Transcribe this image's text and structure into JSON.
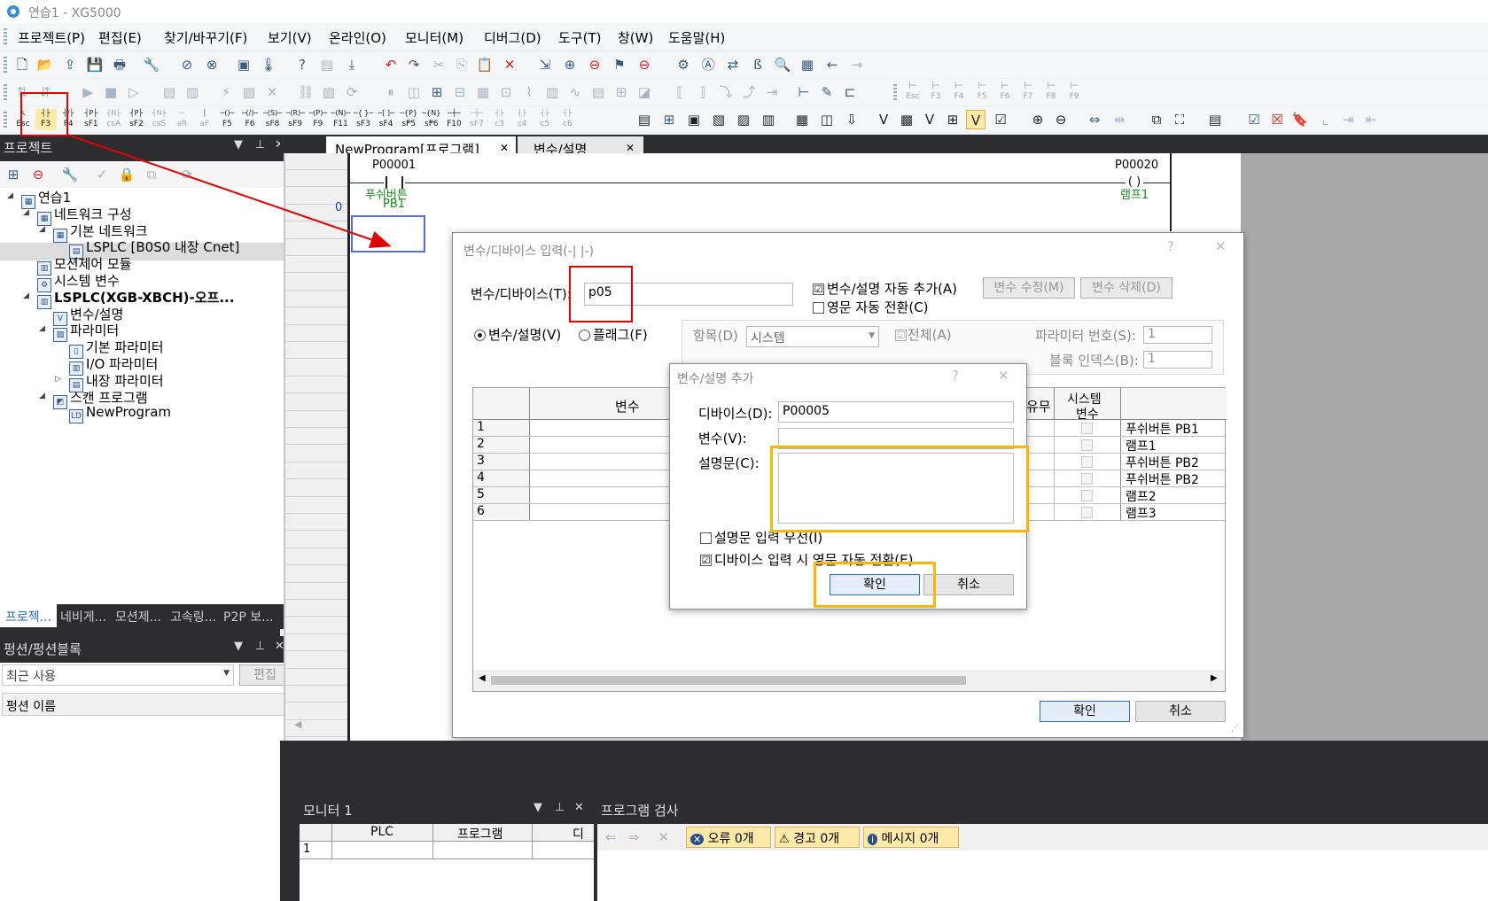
{
  "window": {
    "title": "연습1 - XG5000"
  },
  "menu": [
    "프로젝트(P)",
    "편집(E)",
    "찾기/바꾸기(F)",
    "보기(V)",
    "온라인(O)",
    "모니터(M)",
    "디버그(D)",
    "도구(T)",
    "창(W)",
    "도움말(H)"
  ],
  "toolbar3_keys": [
    {
      "top": "Esc",
      "bot": ""
    },
    {
      "top": "F3",
      "bot": ""
    },
    {
      "top": "F4",
      "bot": ""
    },
    {
      "top": "sF1",
      "bot": ""
    },
    {
      "top": "csA",
      "bot": ""
    },
    {
      "top": "sF2",
      "bot": ""
    },
    {
      "top": "csS",
      "bot": ""
    },
    {
      "top": "aR",
      "bot": ""
    },
    {
      "top": "aF",
      "bot": ""
    },
    {
      "top": "F5",
      "bot": ""
    },
    {
      "top": "F6",
      "bot": ""
    },
    {
      "top": "sF8",
      "bot": ""
    },
    {
      "top": "sF9",
      "bot": ""
    },
    {
      "top": "F9",
      "bot": ""
    },
    {
      "top": "F11",
      "bot": ""
    },
    {
      "top": "sF3",
      "bot": ""
    },
    {
      "top": "sF4",
      "bot": ""
    },
    {
      "top": "sF5",
      "bot": ""
    },
    {
      "top": "sF6",
      "bot": ""
    },
    {
      "top": "F10",
      "bot": ""
    },
    {
      "top": "sF7",
      "bot": ""
    },
    {
      "top": "c3",
      "bot": ""
    },
    {
      "top": "c4",
      "bot": ""
    },
    {
      "top": "c5",
      "bot": ""
    },
    {
      "top": "c6",
      "bot": ""
    }
  ],
  "toolbar2_keys": [
    "Esc",
    "F3",
    "F4",
    "F5",
    "F6",
    "F7",
    "F8",
    "F9"
  ],
  "project_panel": {
    "title": "프로젝트",
    "tree": [
      {
        "label": "연습1",
        "level": 0
      },
      {
        "label": "네트워크 구성",
        "level": 1
      },
      {
        "label": "기본 네트워크",
        "level": 2
      },
      {
        "label": "LSPLC [B0S0 내장 Cnet]",
        "level": 3
      },
      {
        "label": "모션제어 모듈",
        "level": 1
      },
      {
        "label": "시스템 변수",
        "level": 1
      },
      {
        "label": "LSPLC(XGB-XBCH)-오프...",
        "level": 1
      },
      {
        "label": "변수/설명",
        "level": 2
      },
      {
        "label": "파라미터",
        "level": 2
      },
      {
        "label": "기본 파라미터",
        "level": 3
      },
      {
        "label": "I/O 파라미터",
        "level": 3
      },
      {
        "label": "내장 파라미터",
        "level": 3
      },
      {
        "label": "스캔 프로그램",
        "level": 2
      },
      {
        "label": "NewProgram",
        "level": 3
      }
    ],
    "bottom_tabs": [
      "프로젝...",
      "네비게...",
      "모션제...",
      "고속링...",
      "P2P 보..."
    ]
  },
  "function_panel": {
    "title": "펑션/펑션블록",
    "combo_value": "최근 사용",
    "edit_button": "편집",
    "column": "펑션 이름"
  },
  "tabs": [
    {
      "label": "NewProgram[프로그램]",
      "close": "✕"
    },
    {
      "label": "변수/설명",
      "close": "✕"
    }
  ],
  "ladder": {
    "rung_number": "0",
    "contact_device": "P00001",
    "contact_comment1": "푸쉬버튼",
    "contact_comment2": "PB1",
    "coil_device": "P00020",
    "coil_comment": "램프1"
  },
  "var_dialog": {
    "title": "변수/디바이스 입력(-| |-)",
    "help": "?",
    "close": "✕",
    "device_label": "변수/디바이스(T):",
    "device_value": "p05",
    "auto_add_label": "변수/설명 자동 추가(A)",
    "auto_add_checked": "☑",
    "eng_convert_label": "영문 자동 전환(C)",
    "edit_var_button": "변수 수정(M)",
    "delete_var_button": "변수 삭제(D)",
    "radio_var": "변수/설명(V)",
    "radio_flag": "플래그(F)",
    "item_label": "항목(D)",
    "item_value": "시스템",
    "all_label": "전체(A)",
    "param_no_label": "파라미터 번호(S):",
    "param_no_value": "1",
    "block_index_label": "블록 인덱스(B):",
    "block_index_value": "1",
    "grid_header_var": "변수",
    "grid_header_use": "유무",
    "grid_header_sys1": "시스템",
    "grid_header_sys2": "변수",
    "rows": [
      {
        "no": "1",
        "comment": "푸쉬버튼 PB1"
      },
      {
        "no": "2",
        "comment": "램프1"
      },
      {
        "no": "3",
        "comment": "푸쉬버튼 PB2"
      },
      {
        "no": "4",
        "comment": "푸쉬버튼 PB2"
      },
      {
        "no": "5",
        "comment": "램프2"
      },
      {
        "no": "6",
        "comment": "램프3"
      }
    ],
    "ok_button": "확인",
    "cancel_button": "취소"
  },
  "add_dialog": {
    "title": "변수/설명 추가",
    "help": "?",
    "close": "✕",
    "device_label": "디바이스(D):",
    "device_value": "P00005",
    "var_label": "변수(V):",
    "var_value": "",
    "comment_label": "설명문(C):",
    "comment_value": "",
    "prefer_comment_label": "설명문 입력 우선(I)",
    "auto_eng_label": "디바이스 입력 시 영문 자동 전환(E)",
    "auto_eng_checked": "☑",
    "ok_button": "확인",
    "cancel_button": "취소"
  },
  "monitor_panel": {
    "title": "모니터 1",
    "columns": [
      "PLC",
      "프로그램",
      "디"
    ],
    "row_no": "1"
  },
  "check_panel": {
    "title": "프로그램 검사",
    "errors": "오류 0개",
    "warnings": "경고 0개",
    "messages": "메시지 0개"
  },
  "panel_icons": {
    "dropdown": "▼",
    "pin": "📌",
    "close": "✕"
  },
  "colors": {
    "dark_panel": "#2d2d30",
    "accent_blue": "#2d6db5",
    "annotation_red": "#e00000",
    "annotation_yellow": "#f5b700",
    "ladder_comment_green": "#1a8a1a"
  }
}
